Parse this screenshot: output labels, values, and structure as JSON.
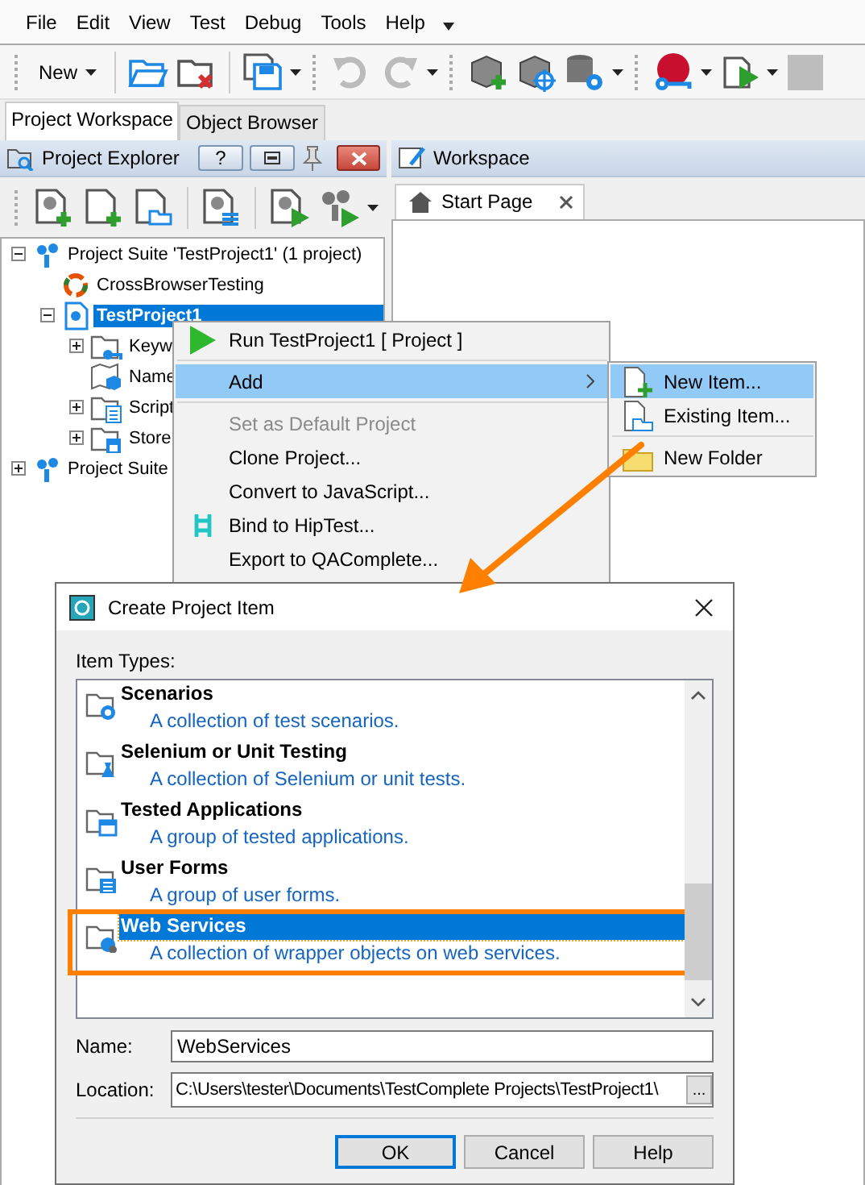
{
  "menu_bar": [
    {
      "label": "File"
    },
    {
      "label": "Edit"
    },
    {
      "label": "View"
    },
    {
      "label": "Test"
    },
    {
      "label": "Debug"
    },
    {
      "label": "Tools"
    },
    {
      "label": "Help"
    }
  ],
  "toolbar": {
    "new_button": "New"
  },
  "dock_tabs": [
    {
      "label": "Project Workspace",
      "selected": true
    },
    {
      "label": "Object Browser",
      "selected": false
    }
  ],
  "project_explorer": {
    "title": "Project Explorer",
    "help_button": "?",
    "tree": [
      {
        "label": "Project Suite 'TestProject1' (1 project)",
        "kind": "suite",
        "expanded": true,
        "selected": false,
        "children": [
          {
            "label": "CrossBrowserTesting",
            "kind": "ring",
            "selected": false
          },
          {
            "label": "TestProject1",
            "kind": "project",
            "expanded": true,
            "selected": true,
            "children": [
              {
                "label": "Keyw",
                "kind": "keyword",
                "expanded": false,
                "selected": false
              },
              {
                "label": "Name",
                "kind": "namemap",
                "selected": false
              },
              {
                "label": "Script",
                "kind": "script",
                "expanded": false,
                "selected": false
              },
              {
                "label": "Store",
                "kind": "stores",
                "expanded": false,
                "selected": false
              }
            ]
          }
        ]
      },
      {
        "label": "Project Suite",
        "kind": "suite",
        "expanded": false,
        "selected": false
      }
    ]
  },
  "workspace": {
    "title": "Workspace",
    "tabs": [
      {
        "label": "Start Page",
        "selected": true
      }
    ]
  },
  "context_menu": [
    {
      "label": "Run TestProject1  [ Project ]",
      "kind": "run",
      "selected": false,
      "disabled": false
    },
    {
      "kind": "separator"
    },
    {
      "label": "Add",
      "kind": "submenu",
      "selected": true,
      "disabled": false
    },
    {
      "kind": "separator"
    },
    {
      "label": "Set as Default Project",
      "kind": "plain",
      "selected": false,
      "disabled": true
    },
    {
      "label": "Clone Project...",
      "kind": "plain",
      "selected": false,
      "disabled": false
    },
    {
      "label": "Convert to JavaScript...",
      "kind": "plain",
      "selected": false,
      "disabled": false
    },
    {
      "label": "Bind to HipTest...",
      "kind": "bind",
      "selected": false,
      "disabled": false
    },
    {
      "label": "Export to QAComplete...",
      "kind": "plain",
      "selected": false,
      "disabled": false
    }
  ],
  "submenu": [
    {
      "label": "New Item...",
      "kind": "new",
      "selected": true
    },
    {
      "label": "Existing Item...",
      "kind": "existing",
      "selected": false
    },
    {
      "kind": "separator"
    },
    {
      "label": "New Folder",
      "kind": "folder",
      "selected": false
    }
  ],
  "dialog": {
    "title": "Create Project Item",
    "list_label": "Item Types:",
    "item_types": [
      {
        "name": "Scenarios",
        "description": "A collection of test scenarios.",
        "kind": "scenarios",
        "selected": false
      },
      {
        "name": "Selenium or Unit Testing",
        "description": "A collection of Selenium or unit tests.",
        "kind": "flask",
        "selected": false
      },
      {
        "name": "Tested Applications",
        "description": "A group of tested applications.",
        "kind": "apps",
        "selected": false
      },
      {
        "name": "User Forms",
        "description": "A group of user forms.",
        "kind": "forms",
        "selected": false
      },
      {
        "name": "Web Services",
        "description": "A collection of wrapper objects on web services.",
        "kind": "web",
        "selected": true
      }
    ],
    "name_label": "Name:",
    "name_value": "WebServices",
    "location_label": "Location:",
    "location_value": "C:\\Users\\tester\\Documents\\TestComplete Projects\\TestProject1\\",
    "browse_button": "...",
    "buttons": [
      {
        "label": "OK",
        "kind": "default"
      },
      {
        "label": "Cancel",
        "kind": "normal"
      },
      {
        "label": "Help",
        "kind": "normal"
      }
    ]
  }
}
